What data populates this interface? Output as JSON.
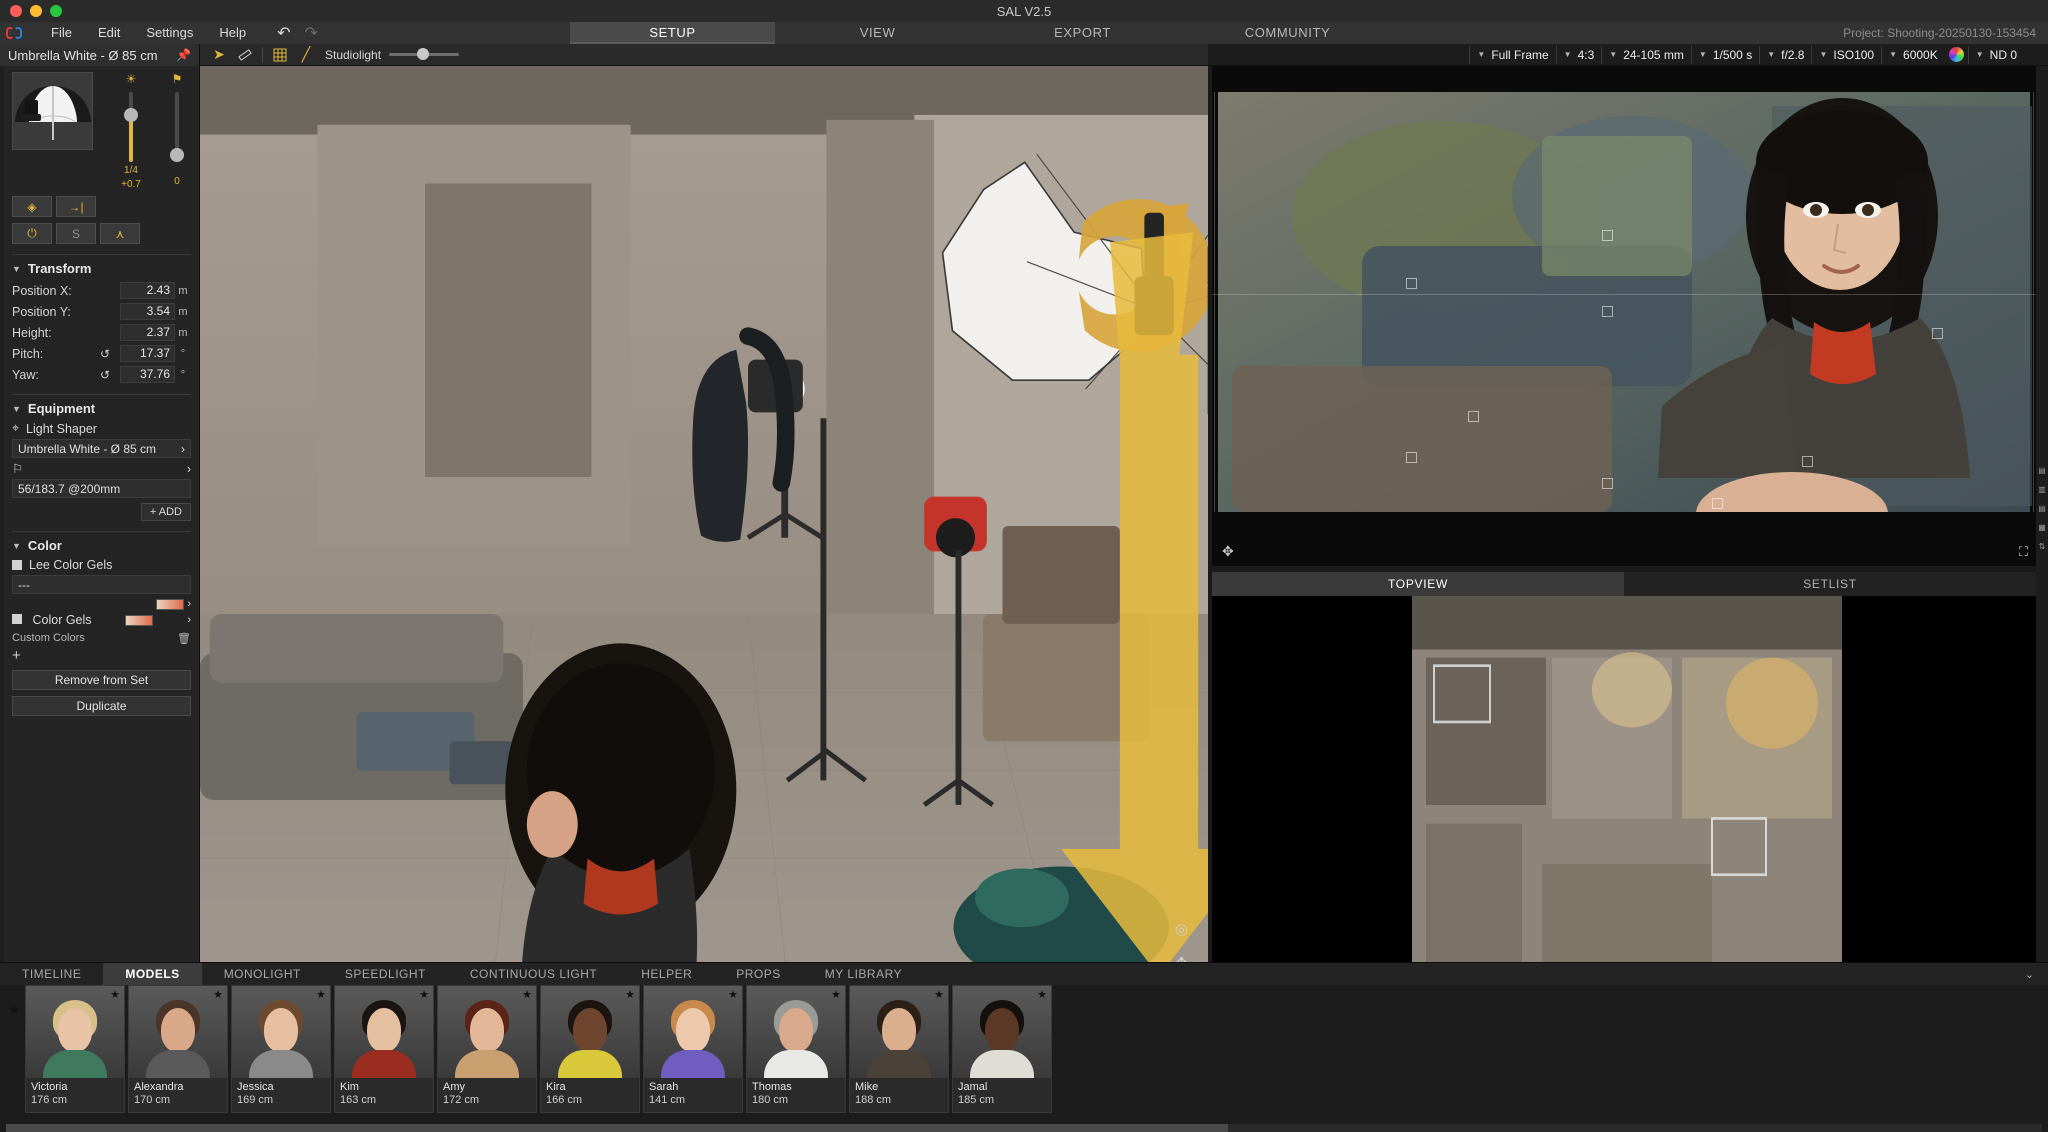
{
  "window": {
    "title": "SAL V2.5"
  },
  "menu": {
    "items": [
      "File",
      "Edit",
      "Settings",
      "Help"
    ],
    "undo_icon": "undo-icon",
    "redo_icon": "redo-icon"
  },
  "main_tabs": [
    {
      "label": "SETUP",
      "active": true
    },
    {
      "label": "VIEW",
      "active": false
    },
    {
      "label": "EXPORT",
      "active": false
    },
    {
      "label": "COMMUNITY",
      "active": false
    }
  ],
  "project": {
    "label": "Project: Shooting-20250130-153454"
  },
  "left_panel": {
    "header": "Umbrella White - Ø 85 cm",
    "pin_icon": "pin-icon",
    "thumbnail_alt": "umbrella-white-thumbnail",
    "power_slider": {
      "icon": "brightness-icon",
      "value": "1/4",
      "value2": "+0.7"
    },
    "zoom_slider": {
      "icon": "flash-head-icon",
      "value": "0"
    },
    "buttons": [
      {
        "name": "target-button",
        "glyph": "◈"
      },
      {
        "name": "snap-to-model-button",
        "glyph": "→|"
      },
      {
        "name": "power-button",
        "glyph": "⏻"
      },
      {
        "name": "solo-button",
        "glyph": "S"
      },
      {
        "name": "stand-button",
        "glyph": "⋏"
      }
    ],
    "transform": {
      "title": "Transform",
      "rows": [
        {
          "label": "Position X:",
          "value": "2.43",
          "unit": "m",
          "reset": false
        },
        {
          "label": "Position Y:",
          "value": "3.54",
          "unit": "m",
          "reset": false
        },
        {
          "label": "Height:",
          "value": "2.37",
          "unit": "m",
          "reset": false
        },
        {
          "label": "Pitch:",
          "value": "17.37",
          "unit": "°",
          "reset": true
        },
        {
          "label": "Yaw:",
          "value": "37.76",
          "unit": "°",
          "reset": true
        }
      ]
    },
    "equipment": {
      "title": "Equipment",
      "light_shaper_label": "Light Shaper",
      "light_shaper_value": "Umbrella White - Ø 85 cm",
      "flash_icon": "flash-head-icon",
      "flash_value": "56/183.7 @200mm",
      "add_label": "+ ADD"
    },
    "color": {
      "title": "Color",
      "lee_label": "Lee Color Gels",
      "lee_value": "---",
      "gels_label": "Color Gels",
      "custom_label": "Custom Colors",
      "trash_icon": "trash-icon",
      "plus_icon": "plus-icon"
    },
    "actions": [
      {
        "label": "Remove from Set",
        "name": "remove-from-set-button"
      },
      {
        "label": "Duplicate",
        "name": "duplicate-button"
      }
    ]
  },
  "viewport_toolbar": {
    "tools": [
      {
        "name": "select-tool",
        "glyph": "➤",
        "selected": true
      },
      {
        "name": "measure-tool",
        "glyph": "📏",
        "selected": false
      },
      {
        "name": "grid-tool",
        "glyph": "▦",
        "selected": true
      },
      {
        "name": "line-tool",
        "glyph": "╱",
        "selected": true
      }
    ],
    "studiolight_label": "Studiolight",
    "studiolight_value": 40
  },
  "viewport_overlay": {
    "icons": [
      "orbit-icon",
      "pan-icon",
      "zoom-icon",
      "fit-icon"
    ],
    "collapse_icon": "collapse-left-icon"
  },
  "camera_toolbar": [
    {
      "name": "sensor-select",
      "value": "Full Frame",
      "caret": true
    },
    {
      "name": "aspect-select",
      "value": "4:3",
      "caret": true
    },
    {
      "name": "lens-select",
      "value": "24-105 mm",
      "caret": true
    },
    {
      "name": "shutter-select",
      "value": "1/500 s",
      "caret": true
    },
    {
      "name": "aperture-select",
      "value": "f/2.8",
      "caret": true
    },
    {
      "name": "iso-select",
      "value": "ISO100",
      "caret": true
    },
    {
      "name": "kelvin-select",
      "value": "6000K",
      "caret": false
    },
    {
      "name": "nd-select",
      "value": "ND 0",
      "caret": true
    }
  ],
  "preview": {
    "move_icon": "pan-hand-icon",
    "fullscreen_icon": "fullscreen-icon"
  },
  "bottom_tabs": [
    {
      "label": "TOPVIEW",
      "active": true
    },
    {
      "label": "SETLIST",
      "active": false
    }
  ],
  "library": {
    "tabs": [
      {
        "label": "TIMELINE",
        "active": false
      },
      {
        "label": "MODELS",
        "active": true
      },
      {
        "label": "MONOLIGHT",
        "active": false
      },
      {
        "label": "SPEEDLIGHT",
        "active": false
      },
      {
        "label": "CONTINUOUS LIGHT",
        "active": false
      },
      {
        "label": "HELPER",
        "active": false
      },
      {
        "label": "PROPS",
        "active": false
      },
      {
        "label": "MY LIBRARY",
        "active": false
      }
    ],
    "collapse_icon": "chevron-down-icon",
    "models": [
      {
        "name": "Victoria",
        "height": "176 cm",
        "skin": "#e8c3a6",
        "hair": "#d8c08a",
        "cloth": "#3f7a5e",
        "starred": true
      },
      {
        "name": "Alexandra",
        "height": "170 cm",
        "skin": "#d9a888",
        "hair": "#4b3528",
        "cloth": "#5a5a5a",
        "starred": true
      },
      {
        "name": "Jessica",
        "height": "169 cm",
        "skin": "#e5bfa0",
        "hair": "#6d4a2f",
        "cloth": "#8a8a8a",
        "starred": true
      },
      {
        "name": "Kim",
        "height": "163 cm",
        "skin": "#e4c0a0",
        "hair": "#1a1512",
        "cloth": "#9b2d20",
        "starred": true
      },
      {
        "name": "Amy",
        "height": "172 cm",
        "skin": "#e3b698",
        "hair": "#5b2417",
        "cloth": "#c8a070",
        "starred": true
      },
      {
        "name": "Kira",
        "height": "166 cm",
        "skin": "#6e4630",
        "hair": "#1c1410",
        "cloth": "#d8c83a",
        "starred": true
      },
      {
        "name": "Sarah",
        "height": "141 cm",
        "skin": "#ecc9ad",
        "hair": "#c88a4a",
        "cloth": "#6f5ec0",
        "starred": true
      },
      {
        "name": "Thomas",
        "height": "180 cm",
        "skin": "#d8a98b",
        "hair": "#9a9a96",
        "cloth": "#e8e8e6",
        "starred": true
      },
      {
        "name": "Mike",
        "height": "188 cm",
        "skin": "#dbae8e",
        "hair": "#2a2018",
        "cloth": "#4a4238",
        "starred": true
      },
      {
        "name": "Jamal",
        "height": "185 cm",
        "skin": "#5c3826",
        "hair": "#14100d",
        "cloth": "#e0ddd6",
        "starred": true
      }
    ]
  }
}
